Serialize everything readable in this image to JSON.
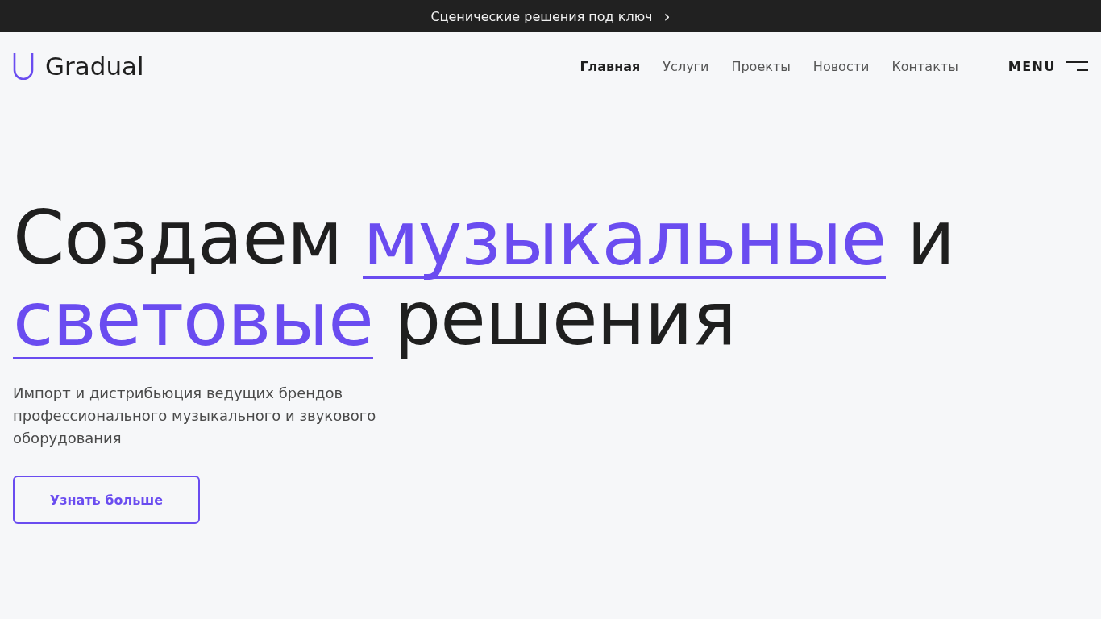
{
  "announcement": {
    "text": "Сценические решения под ключ",
    "arrow": "›"
  },
  "header": {
    "logo": "Gradual",
    "nav": [
      {
        "label": "Главная",
        "selected": true
      },
      {
        "label": "Услуги",
        "selected": false
      },
      {
        "label": "Проекты",
        "selected": false
      },
      {
        "label": "Новости",
        "selected": false
      },
      {
        "label": "Контакты",
        "selected": false
      }
    ],
    "menu_label": "MENU"
  },
  "hero": {
    "headline_lines": [
      [
        {
          "text": "Создаем",
          "kind": "plain"
        },
        {
          "text": "музыкальные",
          "kind": "accent"
        },
        {
          "text": "и",
          "kind": "plain"
        }
      ],
      [
        {
          "text": "световые",
          "kind": "accent"
        },
        {
          "text": "решения",
          "kind": "plain"
        }
      ]
    ],
    "subtitle": "Импорт и дистрибьюция ведущих брендов профессионального музыкального и звукового оборудования",
    "button": "Узнать больше"
  }
}
